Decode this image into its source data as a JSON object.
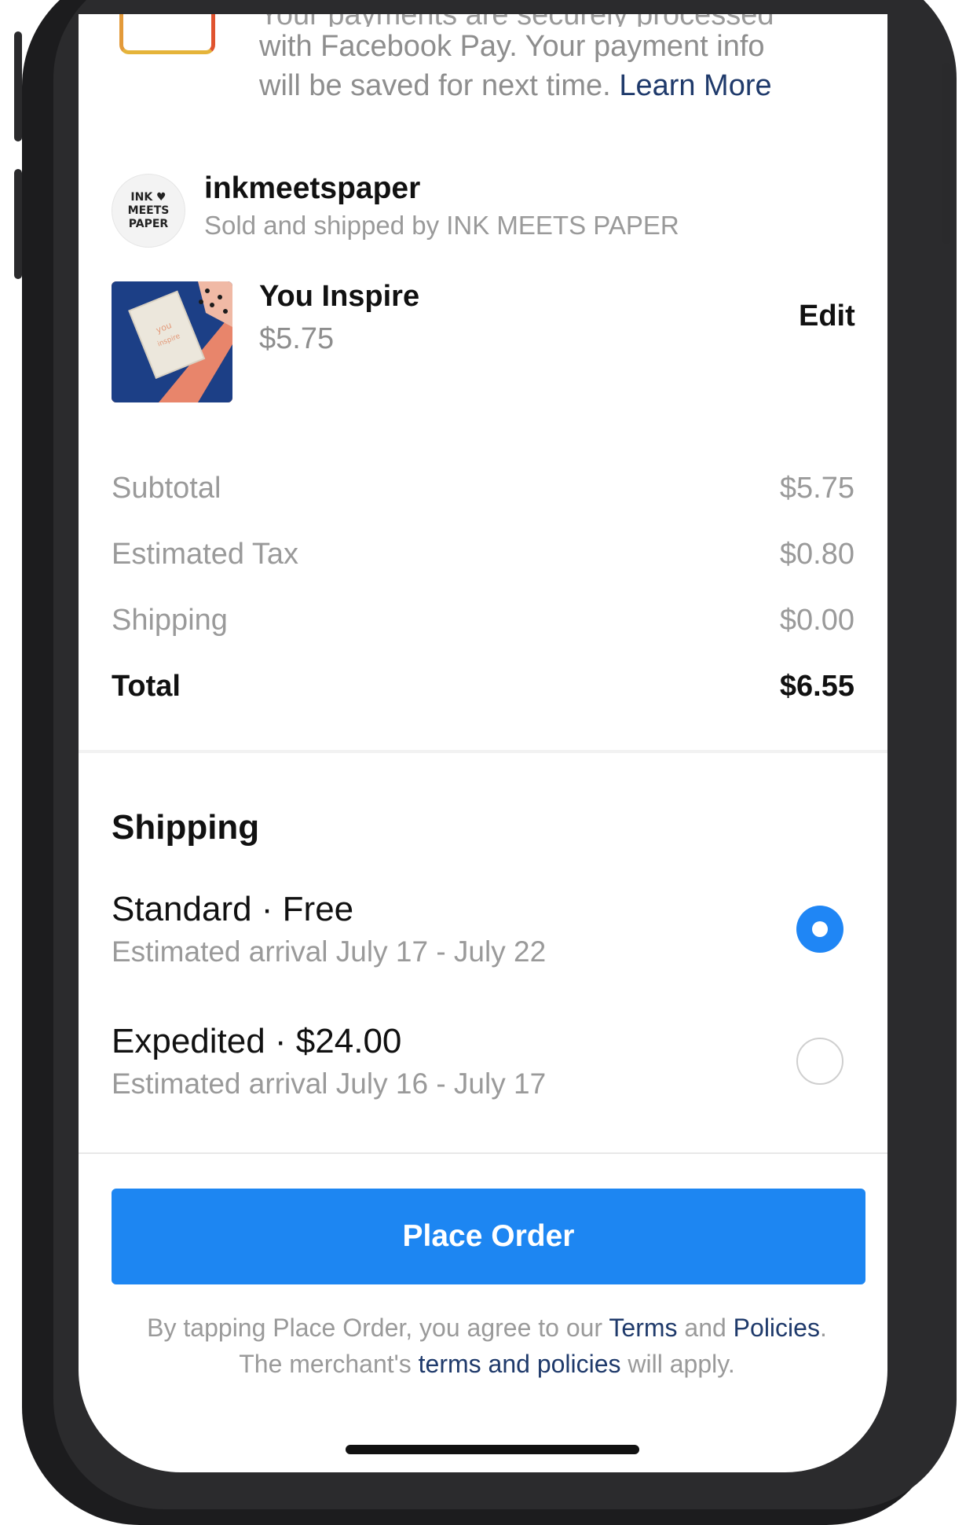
{
  "payment": {
    "clipped_line": "Your payments are securely processed",
    "line_1": "with Facebook Pay. Your payment info",
    "line_2": "will be saved for next time.",
    "learn_more": "Learn More"
  },
  "store": {
    "logo_lines": [
      "INK ♥",
      "MEETS",
      "PAPER"
    ],
    "name": "inkmeetspaper",
    "subtitle": "Sold and shipped by INK MEETS PAPER"
  },
  "product": {
    "name": "You Inspire",
    "price": "$5.75",
    "edit_label": "Edit",
    "image_colors": {
      "peach": "#e8856b",
      "navy": "#1c3f86",
      "card": "#ece7dc"
    }
  },
  "summary": [
    {
      "label": "Subtotal",
      "value": "$5.75"
    },
    {
      "label": "Estimated Tax",
      "value": "$0.80"
    },
    {
      "label": "Shipping",
      "value": "$0.00"
    },
    {
      "label": "Total",
      "value": "$6.55"
    }
  ],
  "shipping": {
    "title": "Shipping",
    "options": [
      {
        "title": "Standard · Free",
        "subtitle": "Estimated arrival July 17 - July 22",
        "selected": true
      },
      {
        "title": "Expedited · $24.00",
        "subtitle": "Estimated arrival July 16 - July 17",
        "selected": false
      }
    ]
  },
  "place_order": {
    "label": "Place Order",
    "color": "#1d86f2"
  },
  "legal": {
    "prefix": "By tapping Place Order, you agree to our",
    "terms": "Terms",
    "and": "and",
    "policies": "Policies",
    "period": ".",
    "line2_prefix": "The merchant's",
    "merchant_link": "terms and policies",
    "line2_suffix": "will apply."
  }
}
